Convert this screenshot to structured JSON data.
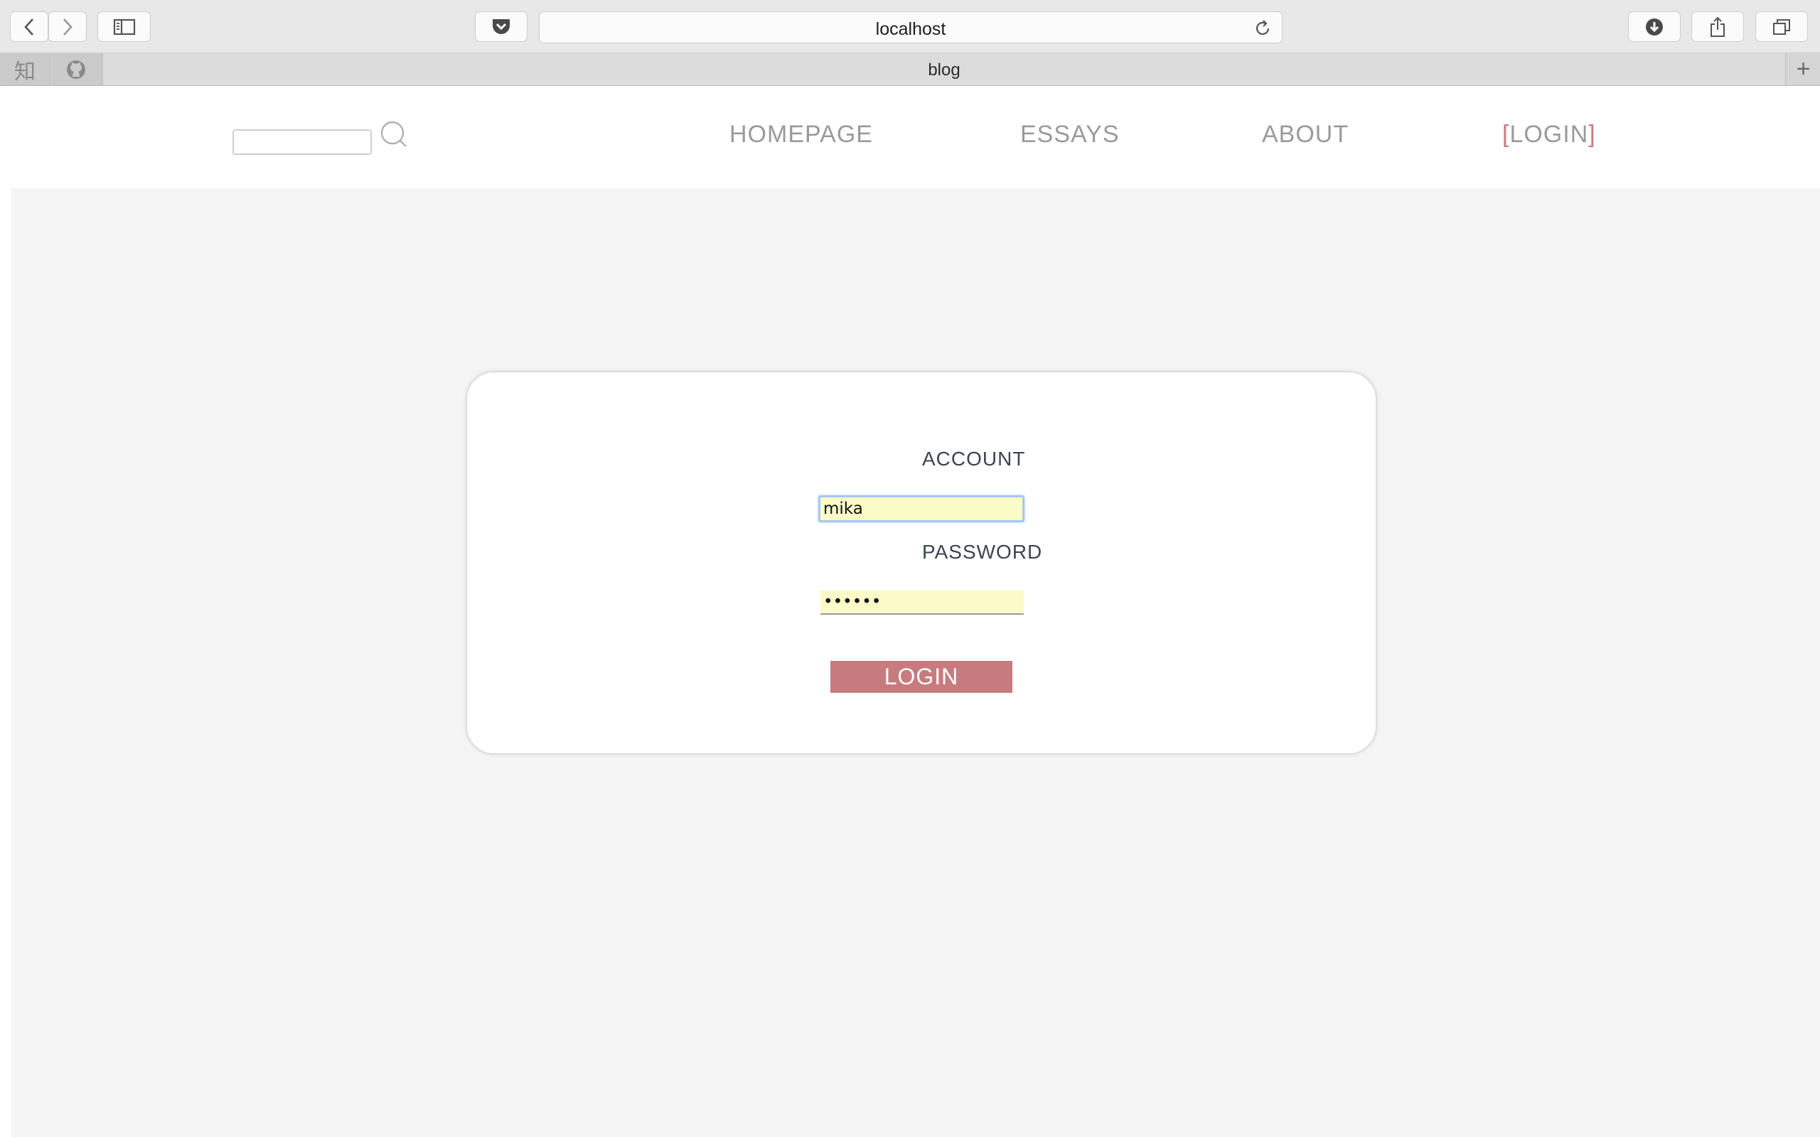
{
  "browser": {
    "url": "localhost",
    "tab_title": "blog",
    "pinned_tabs": [
      {
        "label": "知",
        "icon": "zhihu-icon"
      },
      {
        "label": "",
        "icon": "github-icon"
      }
    ],
    "new_tab_label": "+"
  },
  "header": {
    "search_placeholder": "",
    "nav": {
      "homepage": "HOMEPAGE",
      "essays": "ESSAYS",
      "about": "ABOUT",
      "login_open": "[",
      "login": "LOGIN",
      "login_close": "]"
    },
    "accent_color": "#c97a7a"
  },
  "login_form": {
    "account_label": "ACCOUNT",
    "account_value": "mika",
    "password_label": "PASSWORD",
    "password_value": "••••••",
    "submit_label": "LOGIN",
    "button_color": "#c87b7f",
    "autofill_color": "#fbfbc8"
  }
}
